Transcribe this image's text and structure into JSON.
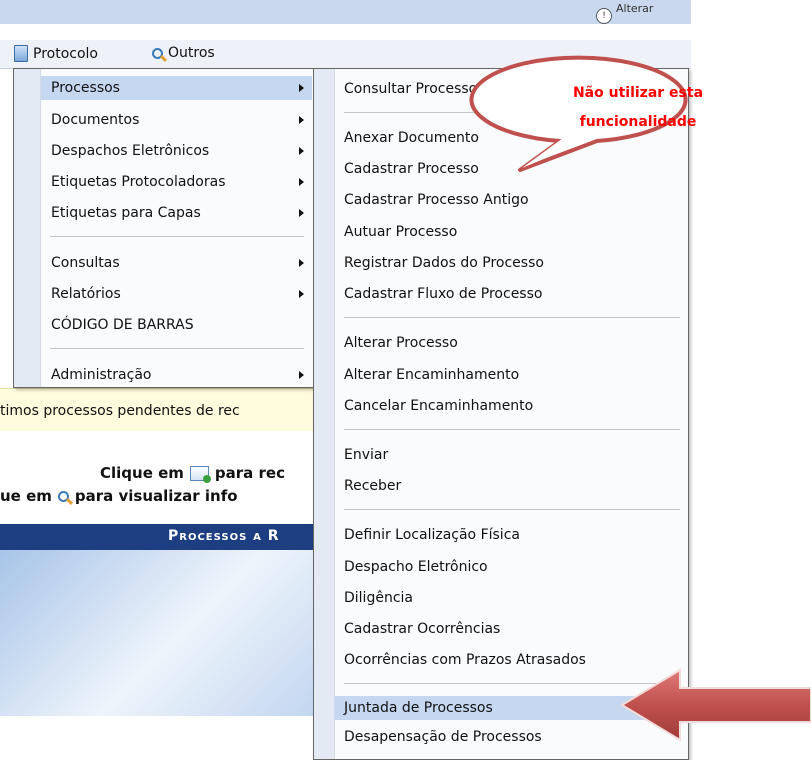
{
  "background": {
    "menubar": {
      "protocolo": "Protocolo",
      "outros": "Outros"
    },
    "topbar_cut": "Alterar",
    "pending_notice": "timos processos pendentes de rec",
    "instruction_receive_prefix": "Clique em",
    "instruction_receive_suffix": "para rec",
    "instruction_view_prefix": "ue em",
    "instruction_view_suffix": "para visualizar info",
    "table_header": "Processos a R"
  },
  "menu_main": {
    "items": [
      {
        "label": "Processos",
        "submenu": true,
        "highlighted": true
      },
      {
        "label": "Documentos",
        "submenu": true
      },
      {
        "label": "Despachos Eletrônicos",
        "submenu": true
      },
      {
        "label": "Etiquetas Protocoladoras",
        "submenu": true
      },
      {
        "label": "Etiquetas para Capas",
        "submenu": true
      },
      {
        "label": "Consultas",
        "submenu": true
      },
      {
        "label": "Relatórios",
        "submenu": true
      },
      {
        "label": "CÓDIGO DE BARRAS",
        "submenu": false
      },
      {
        "label": "Administração",
        "submenu": true
      }
    ]
  },
  "menu_processos": {
    "items": [
      {
        "label": "Consultar Processo"
      },
      {
        "label": "Anexar Documento"
      },
      {
        "label": "Cadastrar Processo"
      },
      {
        "label": "Cadastrar Processo Antigo"
      },
      {
        "label": "Autuar Processo"
      },
      {
        "label": "Registrar Dados do Processo"
      },
      {
        "label": "Cadastrar Fluxo de Processo"
      },
      {
        "label": "Alterar Processo"
      },
      {
        "label": "Alterar Encaminhamento"
      },
      {
        "label": "Cancelar Encaminhamento"
      },
      {
        "label": "Enviar"
      },
      {
        "label": "Receber"
      },
      {
        "label": "Definir Localização Física"
      },
      {
        "label": "Despacho Eletrônico"
      },
      {
        "label": "Diligência"
      },
      {
        "label": "Cadastrar Ocorrências"
      },
      {
        "label": "Ocorrências com Prazos Atrasados"
      },
      {
        "label": "Juntada de Processos",
        "highlighted": true
      },
      {
        "label": "Desapensação de Processos"
      }
    ]
  },
  "annotation": {
    "callout_line1": "Não utilizar esta",
    "callout_line2": "funcionalidade",
    "callout_color": "#c0504d",
    "callout_text_color": "#ff0000"
  },
  "colors": {
    "menu_highlight": "#c5d7f1",
    "header_blue": "#1d3f82"
  }
}
